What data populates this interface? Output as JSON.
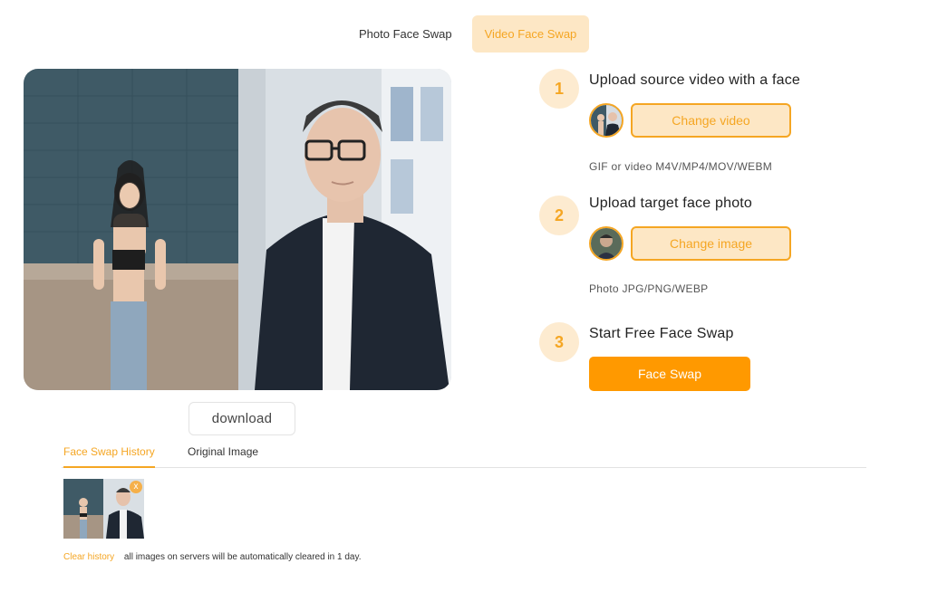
{
  "top_tabs": [
    {
      "label": "Photo Face Swap",
      "active": false
    },
    {
      "label": "Video Face Swap",
      "active": true
    }
  ],
  "preview": {
    "download_label": "download"
  },
  "steps": [
    {
      "number": "1",
      "title": "Upload source video with a face",
      "button": "Change video",
      "hint": "GIF or video M4V/MP4/MOV/WEBM"
    },
    {
      "number": "2",
      "title": "Upload target face photo",
      "button": "Change image",
      "hint": "Photo JPG/PNG/WEBP"
    },
    {
      "number": "3",
      "title": "Start Free Face Swap",
      "button": "Face Swap"
    }
  ],
  "history": {
    "tabs": [
      {
        "label": "Face Swap History",
        "active": true
      },
      {
        "label": "Original Image",
        "active": false
      }
    ],
    "close_glyph": "x",
    "clear_label": "Clear history",
    "note": "all images on servers will be automatically cleared in 1 day."
  },
  "colors": {
    "accent": "#f5a623",
    "accent_light": "#fde7c5",
    "primary": "#ff9900"
  }
}
